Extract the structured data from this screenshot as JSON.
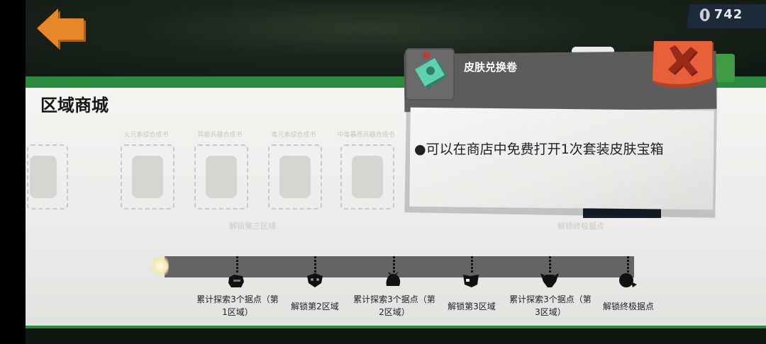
{
  "header": {
    "currency_amount": "742",
    "back_icon": "back-arrow-icon",
    "currency_icon": "coin-icon"
  },
  "section": {
    "title": "区域商城",
    "faded_slot_labels": [
      "火元素综合成书",
      "异能兵器合成书",
      "毒元素综合成书",
      "中毒暴恶兵器合成书"
    ],
    "faded_subtitles": [
      "解锁第三区域",
      "解锁终极据点"
    ]
  },
  "progress": {
    "milestones": [
      {
        "label": "累计探索3个据点（第1区域）",
        "icon": "robot-head-icon"
      },
      {
        "label": "解锁第2区域",
        "icon": "mask-icon"
      },
      {
        "label": "累计探索3个据点（第2区域）",
        "icon": "monster-icon"
      },
      {
        "label": "解锁第3区域",
        "icon": "creature-icon"
      },
      {
        "label": "累计探索3个据点（第3区域）",
        "icon": "beast-icon"
      },
      {
        "label": "解锁终极据点",
        "icon": "boss-icon"
      }
    ]
  },
  "popup": {
    "title": "皮肤兑换卷",
    "item_icon": "skin-voucher-icon",
    "description": "●可以在商店中免费打开1次套装皮肤宝箱",
    "close_icon": "close-x-icon"
  },
  "colors": {
    "accent_green": "#2c8a3e",
    "back_orange": "#e8862a",
    "close_red": "#e8603a",
    "voucher_teal": "#5fd0b0"
  }
}
